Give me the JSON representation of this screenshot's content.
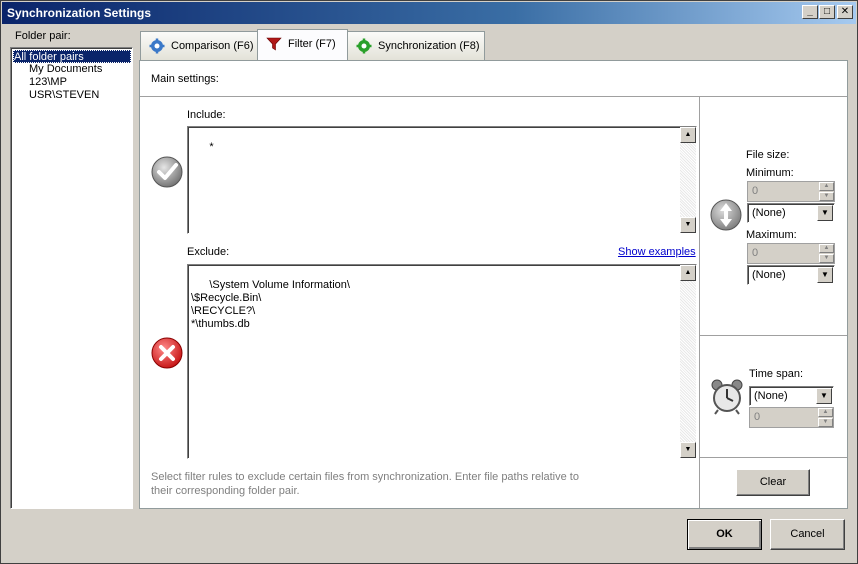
{
  "window": {
    "title": "Synchronization Settings",
    "controls": {
      "minimize": "_",
      "maximize": "□",
      "close": "✕"
    }
  },
  "folder_pairs": {
    "label": "Folder pair:",
    "items": [
      {
        "label": "All folder pairs",
        "selected": true
      },
      {
        "label": "My Documents",
        "selected": false
      },
      {
        "label": "123\\MP",
        "selected": false
      },
      {
        "label": "USR\\STEVEN",
        "selected": false
      }
    ]
  },
  "tabs": [
    {
      "label": "Comparison (F6)",
      "icon": "gear-icon",
      "active": false
    },
    {
      "label": "Filter (F7)",
      "icon": "funnel-icon",
      "active": true
    },
    {
      "label": "Synchronization (F8)",
      "icon": "sync-gear-icon",
      "active": false
    }
  ],
  "filter": {
    "main_settings_label": "Main settings:",
    "include_label": "Include:",
    "include_text": "*",
    "exclude_label": "Exclude:",
    "show_examples": "Show examples",
    "exclude_text": "\\System Volume Information\\\n\\$Recycle.Bin\\\n\\RECYCLE?\\\n*\\thumbs.db",
    "hint": "Select filter rules to exclude certain files from synchronization. Enter file paths relative to their corresponding folder pair.",
    "file_size": {
      "label": "File size:",
      "minimum_label": "Minimum:",
      "minimum_value": "0",
      "minimum_unit": "(None)",
      "maximum_label": "Maximum:",
      "maximum_value": "0",
      "maximum_unit": "(None)"
    },
    "time_span": {
      "label": "Time span:",
      "value": "(None)",
      "count": "0"
    },
    "clear_button": "Clear"
  },
  "buttons": {
    "ok": "OK",
    "cancel": "Cancel"
  },
  "colors": {
    "title_start": "#0a246a",
    "selection": "#0a246a",
    "include_green": "#7a7a7a",
    "exclude_red": "#e03030",
    "link": "#0000cc"
  }
}
